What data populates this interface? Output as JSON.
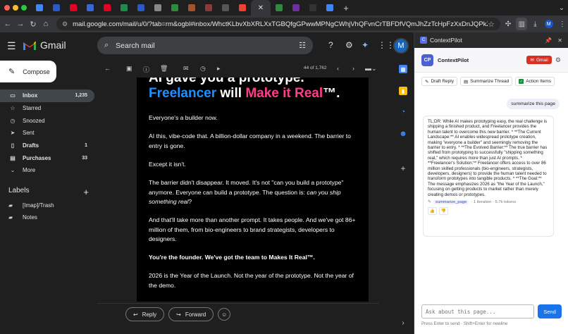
{
  "browser": {
    "tabs": [
      {
        "name": "tab-1",
        "color": "#4285f4"
      },
      {
        "name": "tab-2",
        "color": "#2b59c3"
      },
      {
        "name": "tab-3",
        "color": "#e60023"
      },
      {
        "name": "tab-4",
        "color": "#3867d6"
      },
      {
        "name": "tab-5",
        "color": "#e60023"
      },
      {
        "name": "tab-6",
        "color": "#1f8c4b"
      },
      {
        "name": "tab-7",
        "color": "#2b59c3"
      },
      {
        "name": "tab-8",
        "color": "#888888"
      },
      {
        "name": "tab-9",
        "color": "#2d8a3e"
      },
      {
        "name": "tab-10",
        "color": "#a0522d"
      },
      {
        "name": "tab-11",
        "color": "#8b3a3a"
      },
      {
        "name": "tab-12",
        "color": "#555555"
      },
      {
        "name": "tab-13",
        "color": "#ea4335"
      },
      {
        "name": "tab-14",
        "color": "#2d8a3e"
      },
      {
        "name": "tab-15",
        "color": "#6b2fa0"
      },
      {
        "name": "tab-16",
        "color": "#333333"
      },
      {
        "name": "tab-17",
        "color": "#4285f4"
      }
    ],
    "close_glyph": "✕",
    "new_tab_glyph": "+",
    "url": "mail.google.com/mail/u/0/?tab=rm&ogbl#inbox/WhctKLbvXbXRLXxTGBQfgGPwwMPNgCWhjVhQFvnCrTBFDfVQmJhZzTcHpFzXxDnJQPkZCFL",
    "avatar_letter": "M"
  },
  "gmail": {
    "brand": "Gmail",
    "search_placeholder": "Search mail",
    "compose_label": "Compose",
    "account_letter": "M",
    "nav": [
      {
        "key": "inbox",
        "label": "Inbox",
        "count": "1,235",
        "icon": "inbox-icon",
        "glyph": "▭",
        "selected": true,
        "bold": true
      },
      {
        "key": "starred",
        "label": "Starred",
        "count": "",
        "icon": "star-icon",
        "glyph": "☆",
        "selected": false,
        "bold": false
      },
      {
        "key": "snoozed",
        "label": "Snoozed",
        "count": "",
        "icon": "clock-icon",
        "glyph": "◷",
        "selected": false,
        "bold": false
      },
      {
        "key": "sent",
        "label": "Sent",
        "count": "",
        "icon": "send-icon",
        "glyph": "➤",
        "selected": false,
        "bold": false
      },
      {
        "key": "drafts",
        "label": "Drafts",
        "count": "1",
        "icon": "draft-icon",
        "glyph": "▯",
        "selected": false,
        "bold": true
      },
      {
        "key": "purchases",
        "label": "Purchases",
        "count": "33",
        "icon": "tag-icon",
        "glyph": "▤",
        "selected": false,
        "bold": true
      },
      {
        "key": "more",
        "label": "More",
        "count": "",
        "icon": "chevron-down-icon",
        "glyph": "⌄",
        "selected": false,
        "bold": false
      }
    ],
    "labels_heading": "Labels",
    "labels": [
      "[Imap]/Trash",
      "Notes"
    ],
    "pager": "44 of 1,762",
    "email": {
      "headline_line1": "AI gave you a prototype.",
      "headline_blue": "Freelancer",
      "headline_white": " will ",
      "headline_pink": "Make it Real",
      "headline_tm": "™.",
      "p1": "Everyone's a builder now.",
      "p2": "AI this, vibe-code that. A billion-dollar company in a weekend. The barrier to entry is gone.",
      "p3": "Except it isn't.",
      "p4_a": "The barrier didn't disappear. It moved. It's not \"can you build a prototype\" anymore. Everyone can build a prototype. The question is: ",
      "p4_italic": "can you ship something real",
      "p4_end": "?",
      "p5": "And that'll take more than another prompt. It takes people. And we've got 86+ million of them, from bio-engineers to brand strategists, developers to designers.",
      "p6": "You're the founder. We've got the team to Makes It Real™.",
      "p7": "2026 is the Year of the Launch. Not the year of the prototype. Not the year of the demo."
    },
    "reply_label": "Reply",
    "forward_label": "Forward"
  },
  "panel": {
    "title": "ContextPilot",
    "brand": "ContextPilot",
    "logo_text": "CP",
    "gmail_badge": "Gmail",
    "actions": [
      {
        "key": "draft",
        "label": "Draft Reply",
        "icon": "pencil-icon",
        "glyph": "✎"
      },
      {
        "key": "summarize",
        "label": "Summarize Thread",
        "icon": "document-icon",
        "glyph": "▤"
      },
      {
        "key": "actions",
        "label": "Action Items",
        "icon": "checkbox-icon",
        "glyph": "✓"
      }
    ],
    "user_message": "summarize this page",
    "ai_response": "TL;DR: While AI makes prototyping easy, the real challenge is shipping a finished product, and Freelancer provides the human talent to overcome this new barrier. * **The Current Landscape:** AI enables widespread prototype creation, making \"everyone a builder\" and seemingly removing the barrier to entry. * **The Evolved Barrier:** The true barrier has shifted from prototyping to successfully \"shipping something real,\" which requires more than just AI prompts. * **Freelancer's Solution:** Freelancer offers access to over 86 million skilled professionals (bio-engineers, strategists, developers, designers) to provide the human talent needed to transform prototypes into tangible products. * **The Goal:** The message emphasizes 2026 as \"the Year of the Launch,\" focusing on getting products to market rather than merely creating demos or prototypes.",
    "tool_name": "summarize_page",
    "meta": "· 1 iteration · 5.7k tokens",
    "input_placeholder": "Ask about this page...",
    "send_label": "Send",
    "hint": "Press Enter to send · Shift+Enter for newline"
  }
}
